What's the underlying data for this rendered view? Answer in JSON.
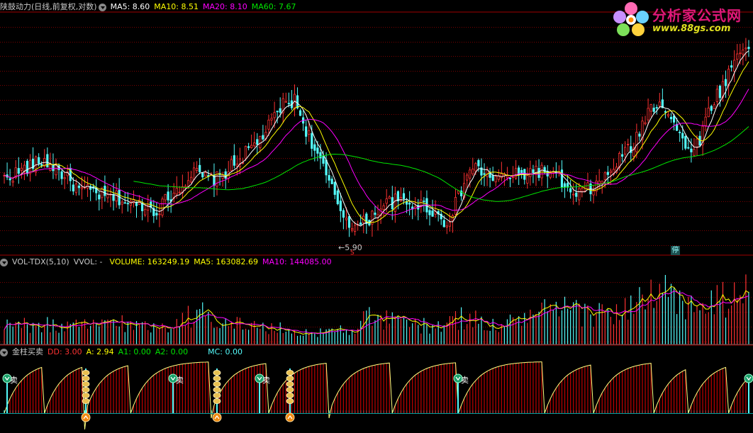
{
  "main_header": {
    "title": "陕鼓动力(日线,前复权,对数)",
    "ma5": "MA5: 8.60",
    "ma10": "MA10: 8.51",
    "ma20": "MA20: 8.10",
    "ma60": "MA60: 7.67"
  },
  "logo": {
    "line1": "分析家公式网",
    "line2": "www.88gs.com"
  },
  "low_label": "5.90",
  "stop_badge": "停",
  "vol_header": {
    "name": "VOL-TDX(5,10)",
    "vvol": "VVOL: -",
    "volume": "VOLUME: 163249.19",
    "ma5": "MA5: 163082.69",
    "ma10": "MA10: 144085.00"
  },
  "ind_header": {
    "name": "金柱买卖",
    "dd": "DD: 3.00",
    "a": "A: 2.94",
    "a1": "A1: 0.00",
    "a2": "A2: 0.00",
    "mc": "MC: 0.00"
  },
  "sell_label": "卖",
  "colors": {
    "up": "#ff3232",
    "down": "#54fcfc",
    "ma5": "#ffffff",
    "ma10": "#ffff00",
    "ma20": "#ff00ff",
    "ma60": "#00e600",
    "grid": "#7a0000",
    "ind_bar": "#c00000",
    "ind_line": "#ffff80",
    "mc": "#54fcfc"
  },
  "chart_data": [
    {
      "type": "candlestick",
      "title": "陕鼓动力(日线,前复权,对数)",
      "ylim": [
        5.6,
        10.0
      ],
      "annotations": [
        {
          "label": "5.90",
          "type": "low"
        }
      ],
      "series": [
        {
          "name": "MA5",
          "last": 8.6
        },
        {
          "name": "MA10",
          "last": 8.51
        },
        {
          "name": "MA20",
          "last": 8.1
        },
        {
          "name": "MA60",
          "last": 7.67
        }
      ],
      "close_path": [
        6.7,
        6.8,
        6.9,
        7.0,
        6.9,
        6.7,
        6.5,
        6.5,
        6.4,
        6.4,
        6.3,
        6.3,
        6.2,
        6.4,
        6.6,
        6.8,
        6.7,
        6.7,
        6.9,
        7.1,
        7.3,
        7.6,
        8.0,
        8.1,
        7.5,
        7.0,
        6.5,
        6.1,
        5.95,
        6.1,
        6.3,
        6.35,
        6.3,
        6.3,
        6.2,
        6.0,
        6.4,
        6.9,
        6.8,
        6.7,
        6.75,
        6.75,
        6.85,
        6.8,
        6.7,
        6.4,
        6.5,
        6.6,
        6.8,
        7.1,
        7.3,
        7.9,
        8.1,
        7.7,
        7.2,
        7.3,
        8.0,
        8.4,
        9.0,
        9.3
      ]
    },
    {
      "type": "bar",
      "title": "VOL-TDX(5,10)",
      "series": [
        {
          "name": "VOLUME",
          "last": 163249.19
        },
        {
          "name": "MA5",
          "last": 163082.69
        },
        {
          "name": "MA10",
          "last": 144085.0
        }
      ],
      "level_path": [
        0.35,
        0.3,
        0.3,
        0.35,
        0.25,
        0.3,
        0.3,
        0.35,
        0.4,
        0.3,
        0.3,
        0.3,
        0.35,
        0.45,
        0.5,
        0.45,
        0.4,
        0.3,
        0.3,
        0.25,
        0.25,
        0.2,
        0.2,
        0.2,
        0.25,
        0.3,
        0.45,
        0.4,
        0.35,
        0.35,
        0.3,
        0.3,
        0.4,
        0.45,
        0.35,
        0.3,
        0.35,
        0.45,
        0.5,
        0.55,
        0.55,
        0.5,
        0.5,
        0.5,
        0.6,
        0.65,
        0.75,
        0.8,
        0.7,
        0.6,
        0.65,
        0.7,
        0.75,
        0.85
      ]
    },
    {
      "type": "bar",
      "title": "金柱买卖",
      "series": [
        {
          "name": "DD",
          "last": 3.0
        },
        {
          "name": "A",
          "last": 2.94
        },
        {
          "name": "A1",
          "last": 0.0
        },
        {
          "name": "A2",
          "last": 0.0
        },
        {
          "name": "MC",
          "last": 0.0
        }
      ],
      "signals": [
        {
          "label": "卖",
          "type": "sell"
        },
        {
          "label": "卖",
          "type": "sell"
        },
        {
          "label": "卖",
          "type": "sell"
        },
        {
          "label": "卖",
          "type": "sell"
        },
        {
          "label": "卖",
          "type": "sell"
        }
      ]
    }
  ]
}
